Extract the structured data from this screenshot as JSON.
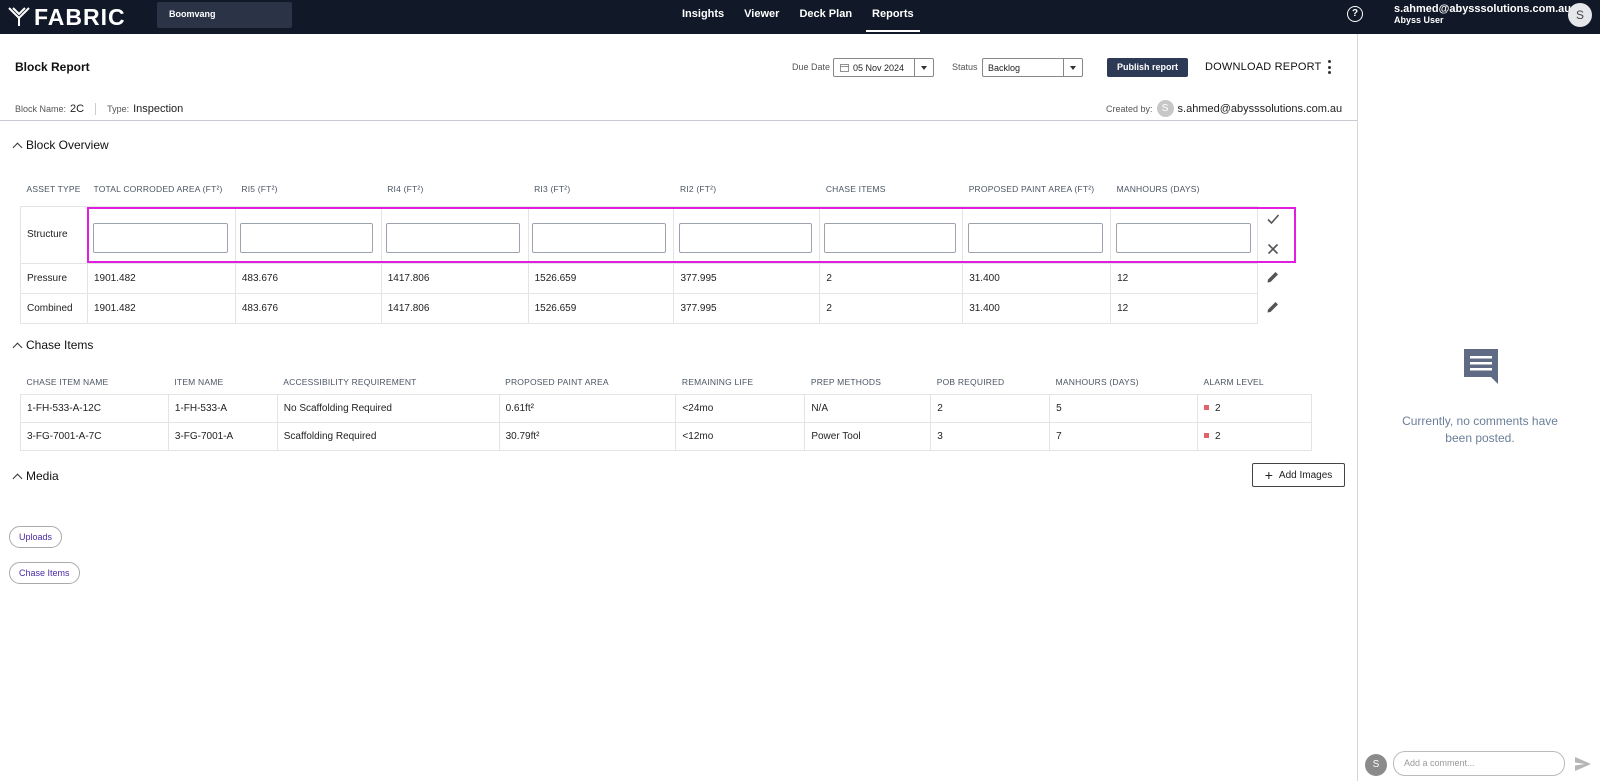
{
  "topbar": {
    "logo": "FABRIC",
    "project": "Boomvang",
    "nav": [
      "Insights",
      "Viewer",
      "Deck Plan",
      "Reports"
    ],
    "active_nav": "Reports",
    "help": "?",
    "user_email": "s.ahmed@abysssolutions.com.au",
    "user_role": "Abyss User",
    "avatar_initial": "S"
  },
  "header": {
    "title": "Block Report",
    "due_label": "Due Date",
    "due_value": "05 Nov 2024",
    "status_label": "Status",
    "status_value": "Backlog",
    "publish_label": "Publish report",
    "download_label": "DOWNLOAD REPORT",
    "block_name_label": "Block Name:",
    "block_name": "2C",
    "type_label": "Type:",
    "type_value": "Inspection",
    "created_label": "Created by:",
    "created_initial": "S",
    "created_email": "s.ahmed@abysssolutions.com.au"
  },
  "block_overview": {
    "title": "Block Overview",
    "columns": [
      "ASSET TYPE",
      "TOTAL CORRODED AREA (FT²)",
      "RI5 (FT²)",
      "RI4 (FT²)",
      "RI3 (FT²)",
      "RI2 (FT²)",
      "CHASE ITEMS",
      "PROPOSED PAINT AREA (FT²)",
      "MANHOURS (DAYS)"
    ],
    "edit_row_label": "Structure",
    "rows": [
      [
        "Pressure",
        "1901.482",
        "483.676",
        "1417.806",
        "1526.659",
        "377.995",
        "2",
        "31.400",
        "12"
      ],
      [
        "Combined",
        "1901.482",
        "483.676",
        "1417.806",
        "1526.659",
        "377.995",
        "2",
        "31.400",
        "12"
      ]
    ]
  },
  "chase_items": {
    "title": "Chase Items",
    "columns": [
      "CHASE ITEM NAME",
      "ITEM NAME",
      "ACCESSIBILITY REQUIREMENT",
      "PROPOSED PAINT AREA",
      "REMAINING LIFE",
      "PREP METHODS",
      "POB REQUIRED",
      "MANHOURS (DAYS)",
      "ALARM LEVEL"
    ],
    "rows": [
      [
        "1-FH-533-A-12C",
        "1-FH-533-A",
        "No Scaffolding Required",
        "0.61ft²",
        "<24mo",
        "N/A",
        "2",
        "5",
        "2"
      ],
      [
        "3-FG-7001-A-7C",
        "3-FG-7001-A",
        "Scaffolding Required",
        "30.79ft²",
        "<12mo",
        "Power Tool",
        "3",
        "7",
        "2"
      ]
    ],
    "alarm_color": "#e0626a"
  },
  "media": {
    "title": "Media",
    "add_images_label": "Add Images",
    "chips": [
      "Uploads",
      "Chase Items"
    ]
  },
  "comments": {
    "empty_text": "Currently, no comments have been posted.",
    "avatar_initial": "S",
    "placeholder": "Add a comment..."
  },
  "colors": {
    "topbar": "#111827",
    "edit_highlight": "#e01ee0",
    "publish": "#2d3a56"
  }
}
